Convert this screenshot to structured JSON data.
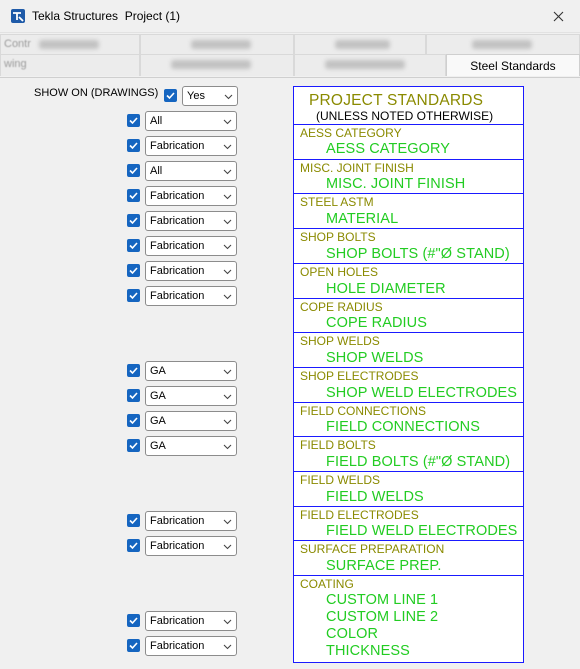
{
  "window": {
    "title": "Tekla Structures  Project (1)"
  },
  "tabs": {
    "row1": [
      {
        "label": "Contr"
      },
      {
        "label": ""
      },
      {
        "label": ""
      },
      {
        "label": ""
      }
    ],
    "row2": [
      {
        "label": "wing"
      },
      {
        "label": ""
      },
      {
        "label": ""
      },
      {
        "label": "Steel Standards",
        "active": true
      }
    ]
  },
  "show_on": {
    "label": "SHOW ON (DRAWINGS)",
    "value": "Yes"
  },
  "option_rows": [
    {
      "value": "All"
    },
    {
      "value": "Fabrication"
    },
    {
      "value": "All"
    },
    {
      "value": "Fabrication"
    },
    {
      "value": "Fabrication"
    },
    {
      "value": "Fabrication"
    },
    {
      "value": "Fabrication"
    },
    {
      "value": "Fabrication"
    },
    {
      "value": "GA"
    },
    {
      "value": "GA"
    },
    {
      "value": "GA"
    },
    {
      "value": "GA"
    },
    {
      "value": "Fabrication"
    },
    {
      "value": "Fabrication"
    },
    {
      "value": "Fabrication"
    },
    {
      "value": "Fabrication"
    }
  ],
  "standards": {
    "title": "PROJECT STANDARDS",
    "subtitle": "(UNLESS NOTED OTHERWISE)",
    "cells": [
      {
        "category": "AESS CATEGORY",
        "values": [
          "AESS CATEGORY"
        ]
      },
      {
        "category": "MISC. JOINT FINISH",
        "values": [
          "MISC. JOINT FINISH"
        ]
      },
      {
        "category": "STEEL ASTM",
        "values": [
          "MATERIAL"
        ]
      },
      {
        "category": "SHOP BOLTS",
        "values": [
          "SHOP BOLTS (#\"Ø STAND)"
        ]
      },
      {
        "category": "OPEN HOLES",
        "values": [
          "HOLE DIAMETER"
        ]
      },
      {
        "category": "COPE RADIUS",
        "values": [
          "COPE RADIUS"
        ]
      },
      {
        "category": "SHOP WELDS",
        "values": [
          "SHOP WELDS"
        ]
      },
      {
        "category": "SHOP ELECTRODES",
        "values": [
          "SHOP WELD ELECTRODES"
        ]
      },
      {
        "category": "FIELD CONNECTIONS",
        "values": [
          "FIELD CONNECTIONS"
        ]
      },
      {
        "category": "FIELD BOLTS",
        "values": [
          "FIELD BOLTS (#\"Ø STAND)"
        ]
      },
      {
        "category": "FIELD WELDS",
        "values": [
          "FIELD WELDS"
        ]
      },
      {
        "category": "FIELD ELECTRODES",
        "values": [
          "FIELD WELD ELECTRODES"
        ]
      },
      {
        "category": "SURFACE PREPARATION",
        "values": [
          "SURFACE PREP."
        ]
      },
      {
        "category": "COATING",
        "values": [
          "CUSTOM LINE 1",
          "CUSTOM LINE 2",
          "COLOR",
          "THICKNESS"
        ]
      }
    ]
  },
  "colors": {
    "checkbox": "#1565c0",
    "frame": "#1a1aff",
    "category_text": "#8a8a00",
    "value_text": "#22cc22"
  }
}
